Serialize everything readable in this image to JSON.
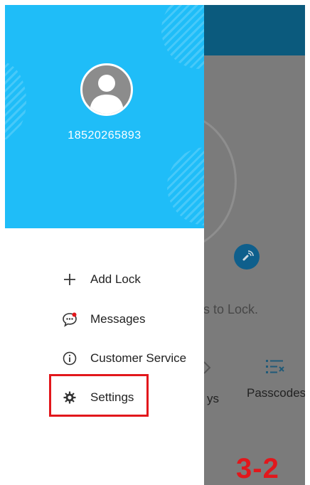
{
  "drawer": {
    "phone_number": "18520265893",
    "items": [
      {
        "label": "Add Lock",
        "icon": "plus-icon"
      },
      {
        "label": "Messages",
        "icon": "chat-bubble-icon"
      },
      {
        "label": "Customer Service",
        "icon": "info-icon"
      },
      {
        "label": "Settings",
        "icon": "gear-icon"
      }
    ]
  },
  "background": {
    "hint_text": "ss to Lock.",
    "tab_keys_label": "ys",
    "tab_passcodes_label": "Passcodes"
  },
  "annotation": {
    "step_label": "3-2"
  },
  "colors": {
    "header_blue": "#1fbdf8",
    "highlight_red": "#e2171c",
    "dim_overlay": "#7b7b7b"
  }
}
